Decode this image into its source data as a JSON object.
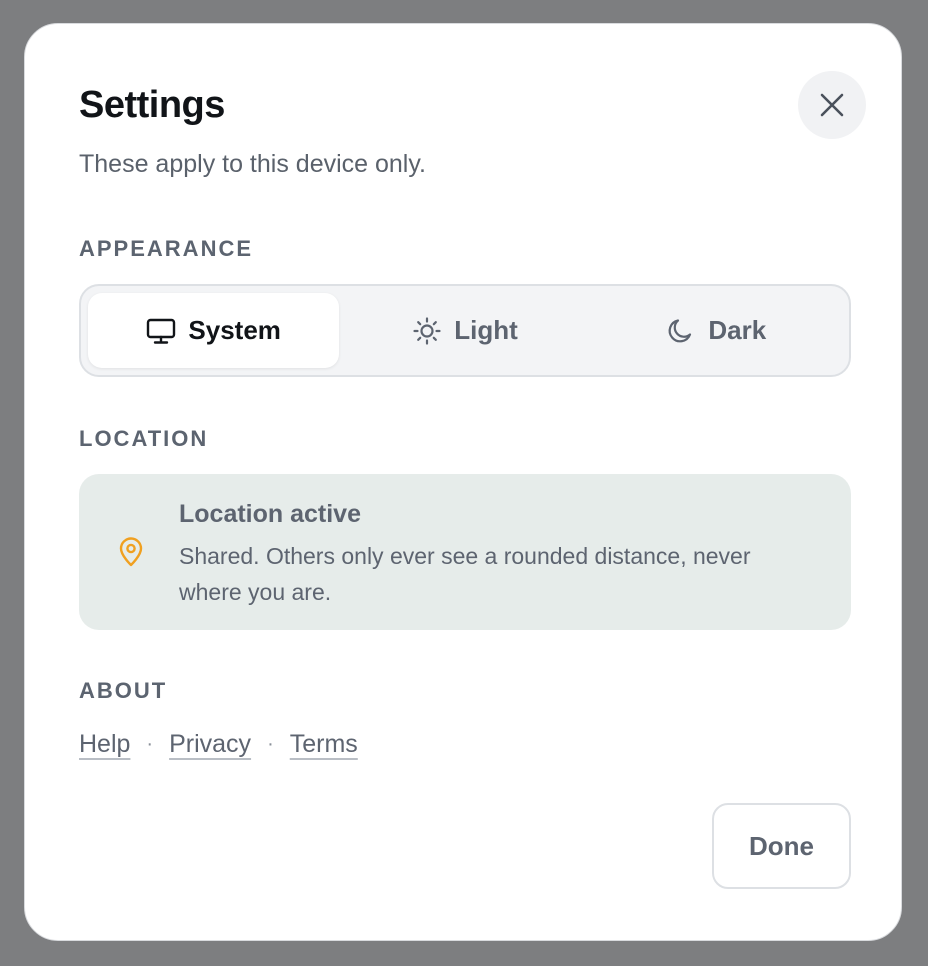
{
  "dialog": {
    "title": "Settings",
    "subtitle": "These apply to this device only.",
    "close_icon": "close-icon"
  },
  "appearance": {
    "label": "APPEARANCE",
    "selected": "System",
    "options": [
      {
        "label": "System",
        "icon": "monitor-icon"
      },
      {
        "label": "Light",
        "icon": "sun-icon"
      },
      {
        "label": "Dark",
        "icon": "moon-icon"
      }
    ]
  },
  "location": {
    "label": "LOCATION",
    "status_title": "Location active",
    "status_description": "Shared. Others only ever see a rounded distance, never where you are.",
    "icon": "map-pin-icon",
    "accent_color": "#f0a020",
    "card_background": "#e6ecea"
  },
  "about": {
    "label": "ABOUT",
    "links": [
      "Help",
      "Privacy",
      "Terms"
    ],
    "separator": "·"
  },
  "footer": {
    "done_label": "Done"
  }
}
